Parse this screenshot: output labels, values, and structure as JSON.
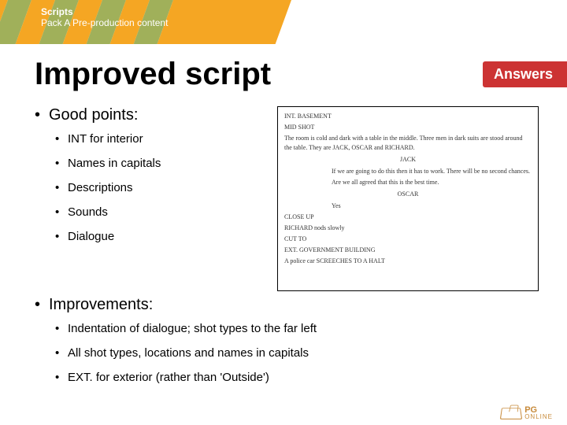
{
  "header": {
    "title": "Scripts",
    "subtitle": "Pack A Pre-production content"
  },
  "slide_title": "Improved script",
  "answers_label": "Answers",
  "good_points": {
    "heading": "Good points:",
    "items": [
      "INT for interior",
      "Names in capitals",
      "Descriptions",
      "Sounds",
      "Dialogue"
    ]
  },
  "improvements": {
    "heading": "Improvements:",
    "items": [
      "Indentation of dialogue; shot types to the far left",
      "All shot types, locations and names in capitals",
      "EXT. for exterior (rather than 'Outside')"
    ]
  },
  "script_sample": {
    "l1": "INT. BASEMENT",
    "l2": "MID SHOT",
    "l3": "The room is cold and dark with a table in the middle. Three men in dark suits are stood around the table. They are JACK, OSCAR and RICHARD.",
    "l4": "JACK",
    "l5": "If we are going to do this then it has to work. There will be no second chances.",
    "l6": "Are we all agreed that this is the best time.",
    "l7": "OSCAR",
    "l8": "Yes",
    "l9": "CLOSE UP",
    "l10": "RICHARD nods slowly",
    "l11": "CUT TO",
    "l12": "EXT. GOVERNMENT BUILDING",
    "l13": "A police car SCREECHES TO A HALT"
  },
  "footer": {
    "brand1": "PG",
    "brand2": "ONLINE"
  }
}
